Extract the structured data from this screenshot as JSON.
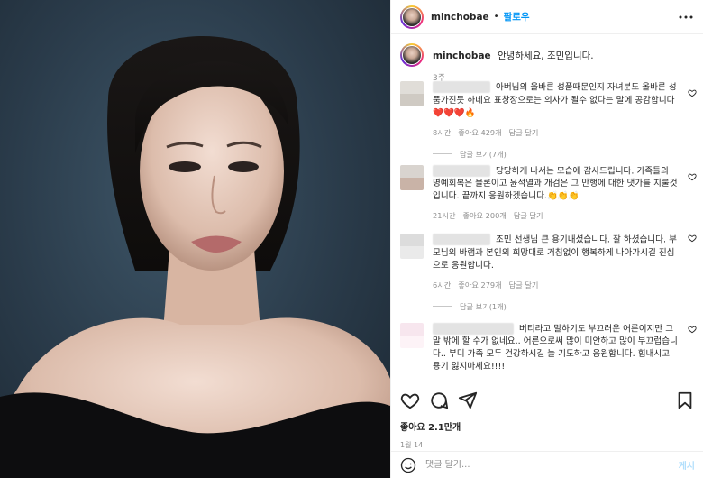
{
  "header": {
    "username": "minchobae",
    "separator": "•",
    "follow_label": "팔로우"
  },
  "caption": {
    "username": "minchobae",
    "text": "안녕하세요, 조민입니다.",
    "time": "3주"
  },
  "comments": [
    {
      "text": "아버님의 올바른 성품때문인지 자녀분도 올바른 성품가진듯 하네요 표창장으로는 의사가 될수 없다는 말에 공감합니다❤️❤️❤️🔥",
      "time": "8시간",
      "likes": "좋아요 429개",
      "reply": "답글 달기",
      "view_replies": "답글 보기(7개)"
    },
    {
      "text": "당당하게 나서는 모습에 감사드립니다. 가족들의 명예회복은 물론이고 윤석열과 개검은 그 만행에 대한 댓가를 치룰것입니다. 끝까지 응원하겠습니다.👏👏👏",
      "time": "21시간",
      "likes": "좋아요 200개",
      "reply": "답글 달기"
    },
    {
      "text": "조민 선생님 큰 용기내셨습니다. 잘 하셨습니다. 부모님의 바램과 본인의 희망대로 거침없이 행복하게 나아가시길 진심으로 응원합니다.",
      "time": "6시간",
      "likes": "좋아요 279개",
      "reply": "답글 달기",
      "view_replies": "답글 보기(1개)"
    },
    {
      "text": "버티라고 말하기도 부끄러운 어른이지만 그 말 밖에 할 수가 없네요.. 어른으로써 많이 미안하고 많이 부끄럽습니다.. 부디 가족 모두 건강하시길 늘 기도하고 응원합니다. 힘내시고 용기 잃지마세요!!!!"
    }
  ],
  "post": {
    "likes": "좋아요 2.1만개",
    "date": "1월 14"
  },
  "comment_box": {
    "placeholder": "댓글 달기...",
    "post_label": "게시"
  },
  "icons": [
    "heart-icon",
    "comment-icon",
    "share-icon",
    "bookmark-icon",
    "emoji-icon"
  ],
  "colors": {
    "accent": "#0095f6",
    "muted": "#8e8e8e",
    "photo_bg": "#2a3b4a"
  }
}
